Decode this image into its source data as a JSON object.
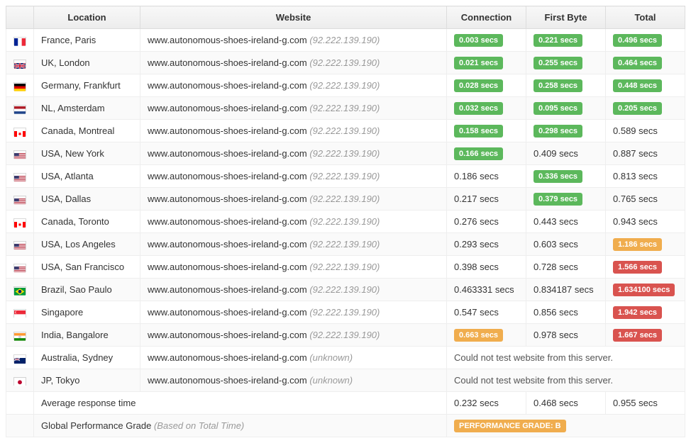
{
  "headers": {
    "location": "Location",
    "website": "Website",
    "connection": "Connection",
    "first_byte": "First Byte",
    "total": "Total"
  },
  "website_domain": "www.autonomous-shoes-ireland-g.com",
  "ip": "(92.222.139.190)",
  "ip_unknown": "(unknown)",
  "error_msg": "Could not test website from this server.",
  "rows": [
    {
      "flag": "fr",
      "location": "France, Paris",
      "conn": {
        "text": "0.003 secs",
        "style": "green"
      },
      "fb": {
        "text": "0.221 secs",
        "style": "green"
      },
      "total": {
        "text": "0.496 secs",
        "style": "green"
      }
    },
    {
      "flag": "gb",
      "location": "UK, London",
      "conn": {
        "text": "0.021 secs",
        "style": "green"
      },
      "fb": {
        "text": "0.255 secs",
        "style": "green"
      },
      "total": {
        "text": "0.464 secs",
        "style": "green"
      }
    },
    {
      "flag": "de",
      "location": "Germany, Frankfurt",
      "conn": {
        "text": "0.028 secs",
        "style": "green"
      },
      "fb": {
        "text": "0.258 secs",
        "style": "green"
      },
      "total": {
        "text": "0.448 secs",
        "style": "green"
      }
    },
    {
      "flag": "nl",
      "location": "NL, Amsterdam",
      "conn": {
        "text": "0.032 secs",
        "style": "green"
      },
      "fb": {
        "text": "0.095 secs",
        "style": "green"
      },
      "total": {
        "text": "0.205 secs",
        "style": "green"
      }
    },
    {
      "flag": "ca",
      "location": "Canada, Montreal",
      "conn": {
        "text": "0.158 secs",
        "style": "green"
      },
      "fb": {
        "text": "0.298 secs",
        "style": "green"
      },
      "total": {
        "text": "0.589 secs",
        "style": "plain"
      }
    },
    {
      "flag": "us",
      "location": "USA, New York",
      "conn": {
        "text": "0.166 secs",
        "style": "green"
      },
      "fb": {
        "text": "0.409 secs",
        "style": "plain"
      },
      "total": {
        "text": "0.887 secs",
        "style": "plain"
      }
    },
    {
      "flag": "us",
      "location": "USA, Atlanta",
      "conn": {
        "text": "0.186 secs",
        "style": "plain"
      },
      "fb": {
        "text": "0.336 secs",
        "style": "green"
      },
      "total": {
        "text": "0.813 secs",
        "style": "plain"
      }
    },
    {
      "flag": "us",
      "location": "USA, Dallas",
      "conn": {
        "text": "0.217 secs",
        "style": "plain"
      },
      "fb": {
        "text": "0.379 secs",
        "style": "green"
      },
      "total": {
        "text": "0.765 secs",
        "style": "plain"
      }
    },
    {
      "flag": "ca",
      "location": "Canada, Toronto",
      "conn": {
        "text": "0.276 secs",
        "style": "plain"
      },
      "fb": {
        "text": "0.443 secs",
        "style": "plain"
      },
      "total": {
        "text": "0.943 secs",
        "style": "plain"
      }
    },
    {
      "flag": "us",
      "location": "USA, Los Angeles",
      "conn": {
        "text": "0.293 secs",
        "style": "plain"
      },
      "fb": {
        "text": "0.603 secs",
        "style": "plain"
      },
      "total": {
        "text": "1.186 secs",
        "style": "orange"
      }
    },
    {
      "flag": "us",
      "location": "USA, San Francisco",
      "conn": {
        "text": "0.398 secs",
        "style": "plain"
      },
      "fb": {
        "text": "0.728 secs",
        "style": "plain"
      },
      "total": {
        "text": "1.566 secs",
        "style": "red"
      }
    },
    {
      "flag": "br",
      "location": "Brazil, Sao Paulo",
      "conn": {
        "text": "0.463331 secs",
        "style": "plain"
      },
      "fb": {
        "text": "0.834187 secs",
        "style": "plain"
      },
      "total": {
        "text": "1.634100 secs",
        "style": "red"
      }
    },
    {
      "flag": "sg",
      "location": "Singapore",
      "conn": {
        "text": "0.547 secs",
        "style": "plain"
      },
      "fb": {
        "text": "0.856 secs",
        "style": "plain"
      },
      "total": {
        "text": "1.942 secs",
        "style": "red"
      }
    },
    {
      "flag": "in",
      "location": "India, Bangalore",
      "conn": {
        "text": "0.663 secs",
        "style": "orange"
      },
      "fb": {
        "text": "0.978 secs",
        "style": "plain"
      },
      "total": {
        "text": "1.667 secs",
        "style": "red"
      }
    },
    {
      "flag": "au",
      "location": "Australia, Sydney",
      "error": true
    },
    {
      "flag": "jp",
      "location": "JP, Tokyo",
      "error": true
    }
  ],
  "avg": {
    "label": "Average response time",
    "conn": "0.232 secs",
    "fb": "0.468 secs",
    "total": "0.955 secs"
  },
  "grade": {
    "label": "Global Performance Grade",
    "sublabel": "(Based on Total Time)",
    "badge": "PERFORMANCE GRADE:  B"
  }
}
